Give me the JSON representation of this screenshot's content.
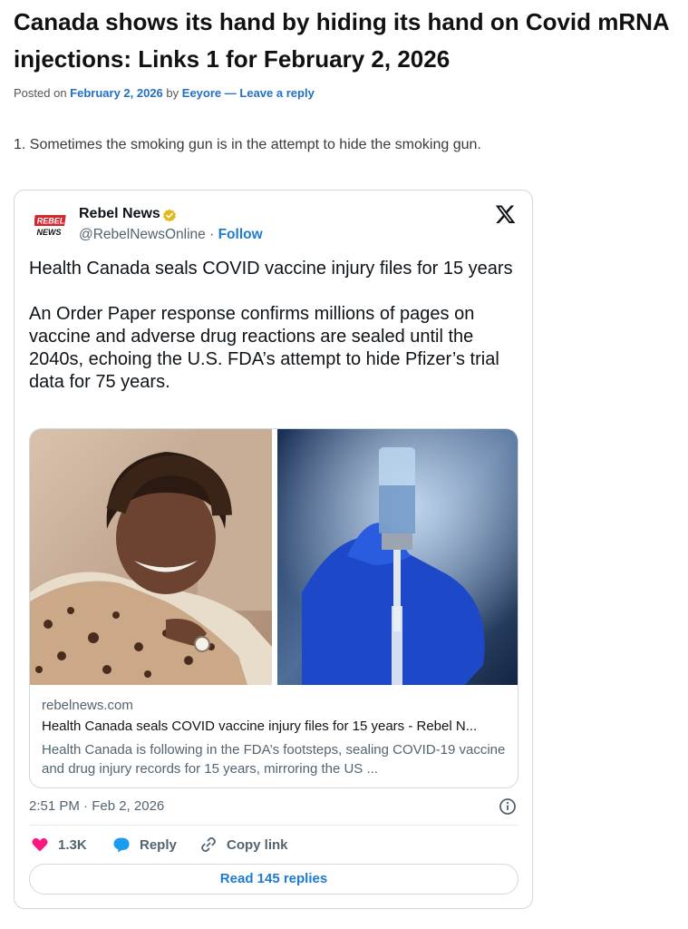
{
  "post": {
    "title": "Canada shows its hand by hiding its hand on Covid mRNA injections: Links 1 for February 2, 2026",
    "meta": {
      "posted_on_label": "Posted on",
      "date": "February 2, 2026",
      "by_label": "by",
      "author": "Eeyore",
      "separator": "—",
      "reply_link": "Leave a reply"
    },
    "paragraph": "1. Sometimes the smoking gun is in the attempt to hide the smoking gun."
  },
  "tweet": {
    "author": {
      "name": "Rebel News",
      "handle": "@RebelNewsOnline",
      "dot": "·",
      "follow": "Follow",
      "logo_text_top": "REBEL",
      "logo_text_bottom": "NEWS"
    },
    "text": [
      "Health Canada seals COVID vaccine injury files for 15 years",
      "An Order Paper response confirms millions of pages on vaccine and adverse drug reactions are sealed until the 2040s, echoing the U.S. FDA’s attempt to hide Pfizer’s trial data for 75 years."
    ],
    "card": {
      "domain": "rebelnews.com",
      "title": "Health Canada seals COVID vaccine injury files for 15 years - Rebel N...",
      "description": "Health Canada is following in the FDA’s footsteps, sealing COVID-19 vaccine and drug injury records for 15 years, mirroring the US ..."
    },
    "timestamp": "2:51 PM · Feb 2, 2026",
    "actions": {
      "likes": "1.3K",
      "reply": "Reply",
      "copy_link": "Copy link"
    },
    "read_replies": "Read 145 replies"
  },
  "colors": {
    "link": "#2270c4",
    "twitter_blue": "#1d7bd4",
    "heart": "#f91880",
    "muted": "#536471",
    "verified_gold": "#e2b719",
    "rebel_red": "#d7262e"
  },
  "icons": {
    "x": "x-logo-icon",
    "verified": "verified-badge-icon",
    "info": "info-icon",
    "heart": "heart-icon",
    "reply": "reply-bubble-icon",
    "link": "link-icon"
  }
}
